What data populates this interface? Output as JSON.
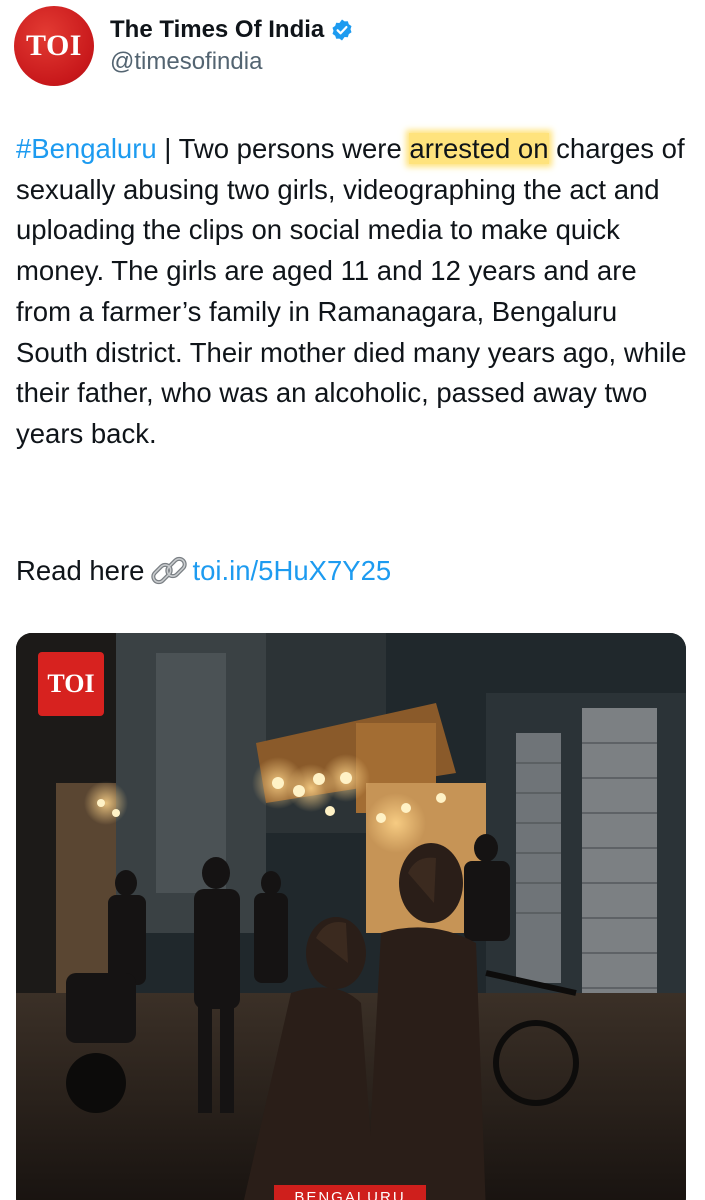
{
  "account": {
    "avatar_text": "TOI",
    "display_name": "The Times Of India",
    "handle": "@timesofindia",
    "verified": true,
    "avatar_color": "#c8181b",
    "verified_color": "#1d9bf0"
  },
  "tweet": {
    "hashtag": "#Bengaluru",
    "text_part1": " | Two persons were ",
    "highlighted": "arrested on",
    "text_part2": " charges of sexually abusing two girls, videographing the act and uploading the clips on social media to make quick money. The girls are aged 11 and 12 years and are from a farmer’s family in Ramanagara, Bengaluru South district. Their mother died many years ago, while their father, who was an alcoholic, passed away two years back.",
    "read_label": "Read here",
    "link_icon": "link-icon",
    "link_text": "toi.in/5HuX7Y25",
    "highlight_color": "#ffe37d",
    "link_color": "#1d9bf0"
  },
  "media": {
    "badge_text": "TOI",
    "bottom_label": "BENGALURU"
  }
}
